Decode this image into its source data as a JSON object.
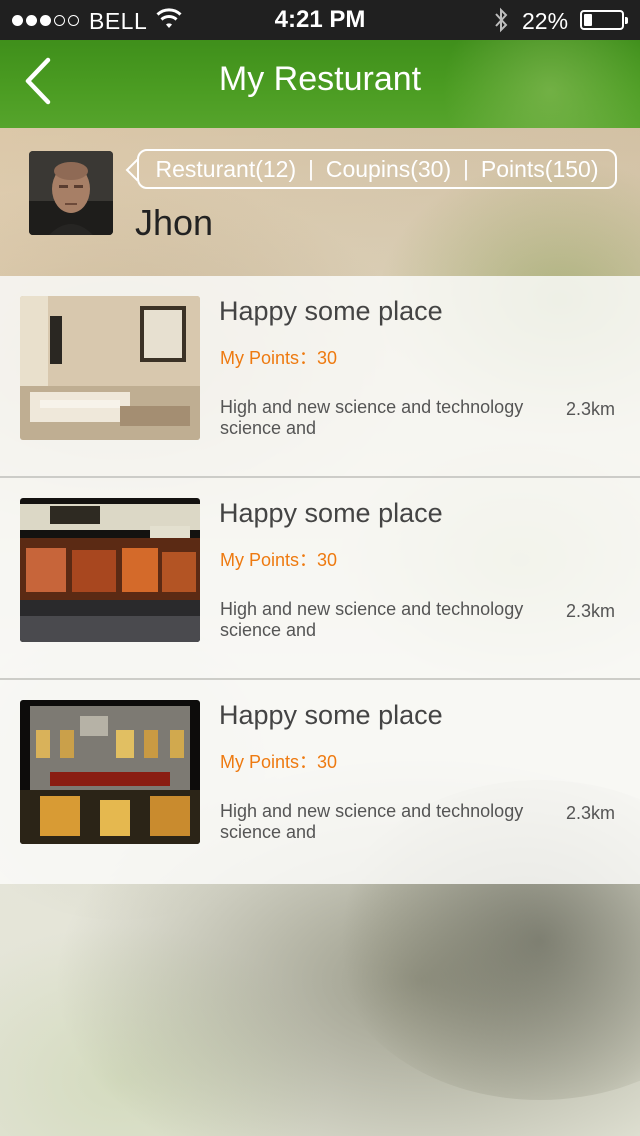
{
  "status_bar": {
    "carrier": "BELL",
    "time": "4:21 PM",
    "battery_percent": "22%",
    "battery_level": 0.22,
    "signal_bars_filled": 3,
    "signal_bars_total": 5,
    "icons": [
      "signal-dots-icon",
      "wifi-icon",
      "bluetooth-icon",
      "battery-icon"
    ]
  },
  "nav": {
    "title": "My Resturant",
    "back_icon": "chevron-left-icon"
  },
  "profile": {
    "name": "Jhon",
    "stats": [
      {
        "label": "Resturant(12)"
      },
      {
        "label": "Coupins(30)"
      },
      {
        "label": "Points(150)"
      }
    ],
    "separator": "|"
  },
  "restaurants": [
    {
      "title": "Happy some place",
      "points": "My Points：30",
      "description": "High and new science and technology science and",
      "distance": "2.3km",
      "thumb": "hotel-room-photo"
    },
    {
      "title": "Happy some place",
      "points": "My Points：30",
      "description": "High and new science and technology science and",
      "distance": "2.3km",
      "thumb": "restaurant-storefront-night-photo"
    },
    {
      "title": "Happy some place",
      "points": "My Points：30",
      "description": "High and new science and technology science and",
      "distance": "2.3km",
      "thumb": "building-facade-night-photo"
    }
  ],
  "colors": {
    "nav_green": "#4b9c22",
    "points_orange": "#ee7a10",
    "status_bar_bg": "#202020"
  }
}
